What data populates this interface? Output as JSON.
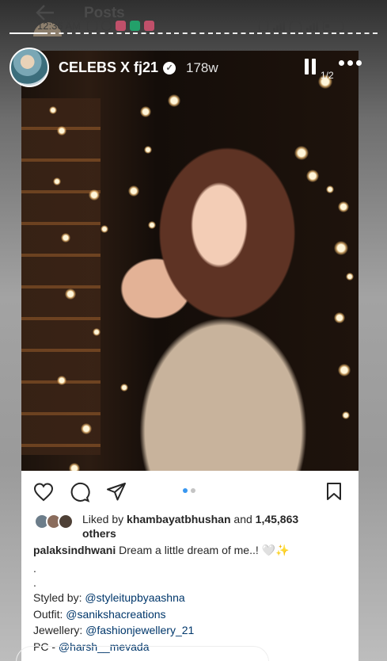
{
  "underlying": {
    "title": "Posts"
  },
  "status_bar": {
    "time": "12:36 AM",
    "colors": {
      "text": "#3a3a3a"
    }
  },
  "story": {
    "username": "CELEBS X fj21",
    "age": "178w",
    "page_indicator": "1/2",
    "segments": 9,
    "active_segment": 0
  },
  "post": {
    "liked_by_prefix": "Liked by",
    "liked_by_user": "khambayatbhushan",
    "liked_and": "and",
    "liked_count": "1,45,863",
    "liked_others": "others",
    "caption_user": "palaksindhwani",
    "caption_text": "Dream a little dream of me..! 🤍✨",
    "dot1": ".",
    "dot2": ".",
    "lines": [
      {
        "label": "Styled by:",
        "handle": "@styleitupbyaashna"
      },
      {
        "label": "Outfit:",
        "handle": "@sanikshacreations"
      },
      {
        "label": "Jewellery:",
        "handle": "@fashionjewellery_21"
      },
      {
        "label": "PC -",
        "handle": "@harsh__mevada"
      }
    ],
    "carousel": {
      "count": 2,
      "current": 1
    }
  },
  "colors": {
    "accent_blue": "#3897f0",
    "link": "#00376b",
    "text": "#262626"
  }
}
